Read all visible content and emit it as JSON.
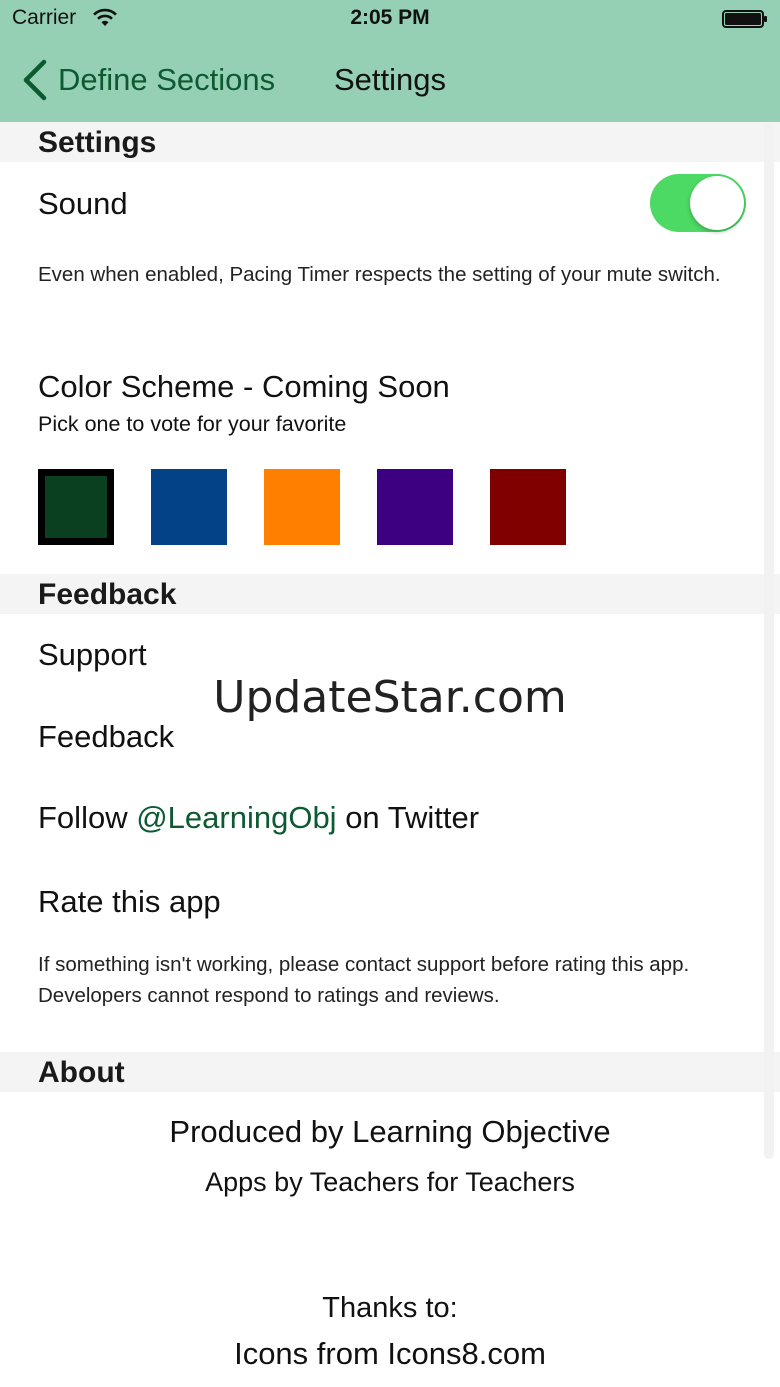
{
  "status_bar": {
    "carrier": "Carrier",
    "time": "2:05 PM"
  },
  "nav": {
    "back_label": "Define Sections",
    "title": "Settings"
  },
  "settings": {
    "header": "Settings",
    "sound_label": "Sound",
    "sound_enabled": true,
    "sound_note": "Even when enabled, Pacing Timer respects the setting of your mute switch.",
    "color_scheme_title": "Color Scheme - Coming Soon",
    "color_scheme_subtitle": "Pick one to vote for your favorite",
    "swatches": [
      "#0a4020",
      "#034286",
      "#ff8000",
      "#3d0080",
      "#800000"
    ],
    "selected_swatch": 0
  },
  "feedback": {
    "header": "Feedback",
    "support": "Support",
    "feedback": "Feedback",
    "follow_prefix": "Follow ",
    "twitter_handle": "@LearningObj",
    "follow_suffix": " on Twitter",
    "rate": "Rate this app",
    "rate_note": "If something isn't working, please contact support before rating this app. Developers cannot respond to ratings and reviews."
  },
  "about": {
    "header": "About",
    "produced_by": "Produced by Learning Objective",
    "tagline": "Apps by Teachers for Teachers",
    "thanks": "Thanks to:",
    "icons_credit": "Icons from Icons8.com"
  },
  "watermark": "UpdateStar.com",
  "colors": {
    "nav_bar": "#95d0b4",
    "accent": "#0d5a32",
    "toggle_on": "#4cd964",
    "section_bg": "#f4f4f4"
  }
}
